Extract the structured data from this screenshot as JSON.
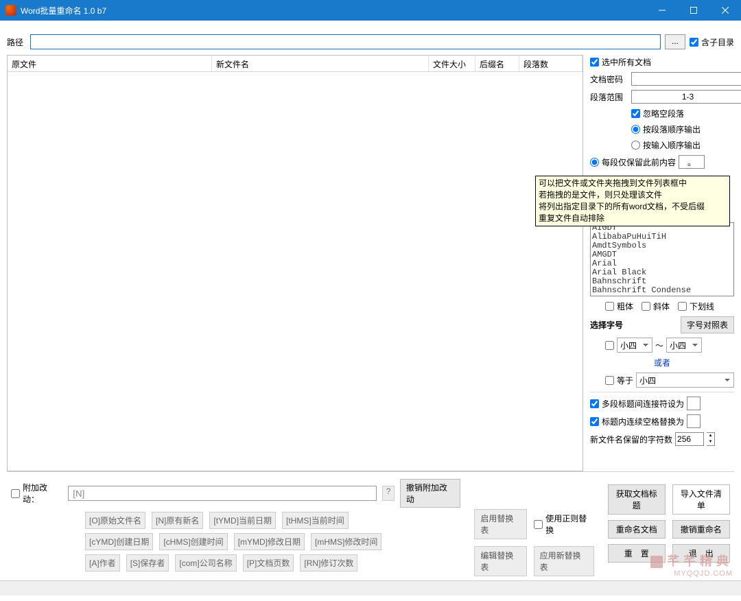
{
  "title": "Word批量重命名 1.0 b7",
  "path": {
    "label": "路径",
    "browse": "...",
    "subdirs": "含子目录"
  },
  "grid": {
    "cols": [
      "原文件",
      "新文件名",
      "文件大小",
      "后缀名",
      "段落数"
    ]
  },
  "side": {
    "selectAll": "选中所有文档",
    "pwdLabel": "文档密码",
    "rangeLabel": "段落范围",
    "rangeValue": "1-3",
    "skipEmpty": "忽略空段落",
    "outByPara": "按段落顺序输出",
    "outByInput": "按输入顺序输出",
    "keepBefore": "每段仅保留此前内容",
    "keepBeforeVal": "。",
    "fonts": [
      "AIGDT",
      "AlibabaPuHuiTiH",
      "AmdtSymbols",
      "AMGDT",
      "Arial",
      "Arial Black",
      "Bahnschrift",
      "Bahnschrift Condense"
    ],
    "bold": "粗体",
    "italic": "斜体",
    "underline": "下划线",
    "selSize": "选择字号",
    "sizeChart": "字号对照表",
    "sizeA": "小四",
    "tilde": "～",
    "sizeB": "小四",
    "or": "或者",
    "eq": "等于",
    "sizeC": "小四",
    "multiSep": "多段标题间连接符设为",
    "spaceRepl": "标题内连续空格替换为",
    "keepChars": "新文件名保留的字符数",
    "keepCharsVal": "256"
  },
  "tooltip": [
    "可以把文件或文件夹拖拽到文件列表框中",
    "若拖拽的是文件，则只处理该文件",
    "将列出指定目录下的所有word文档，不受后缀",
    "重复文件自动排除"
  ],
  "bottom": {
    "append": "附加改动：",
    "pattern": "[N]",
    "q": "?",
    "undoAppend": "撤销附加改动",
    "tags1": [
      "[O]原始文件名",
      "[N]原有新名",
      "[tYMD]当前日期",
      "[tHMS]当前时间"
    ],
    "tags2": [
      "[cYMD]创建日期",
      "[cHMS]创建时间",
      "[mYMD]修改日期",
      "[mHMS]修改时间"
    ],
    "tags3": [
      "[A]作者",
      "[S]保存者",
      "[com]公司名称",
      "[P]文档页数",
      "[RN]修订次数"
    ],
    "enableRepl": "启用替换表",
    "useRegex": "使用正则替换",
    "editRepl": "编辑替换表",
    "applyRepl": "应用新替换表",
    "getTitle": "获取文档标题",
    "importList": "导入文件清单",
    "rename": "重命名文档",
    "undoRename": "撤销重命名",
    "reset": "重　置",
    "exit": "退　出"
  },
  "wm": {
    "cn": "芊芊精典",
    "en": "MYQQJD.COM"
  }
}
